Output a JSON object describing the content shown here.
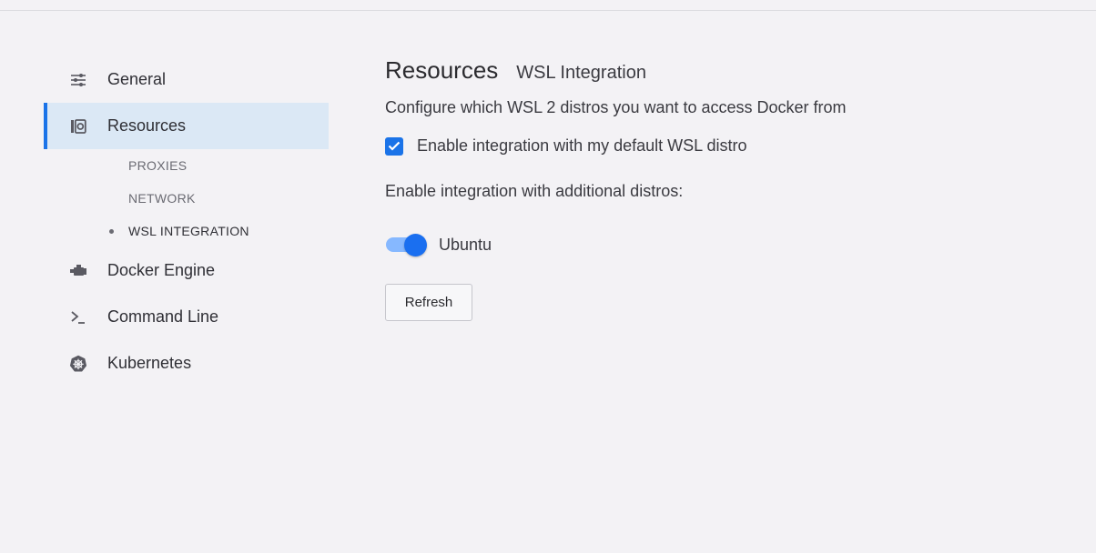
{
  "sidebar": {
    "items": [
      {
        "label": "General",
        "icon": "sliders-icon"
      },
      {
        "label": "Resources",
        "icon": "resources-icon"
      },
      {
        "label": "Docker Engine",
        "icon": "engine-icon"
      },
      {
        "label": "Command Line",
        "icon": "terminal-prompt-icon"
      },
      {
        "label": "Kubernetes",
        "icon": "kubernetes-helm-icon"
      }
    ],
    "sub_items": [
      {
        "label": "PROXIES"
      },
      {
        "label": "NETWORK"
      },
      {
        "label": "WSL INTEGRATION"
      }
    ],
    "active_item": "Resources",
    "active_sub_item": "WSL INTEGRATION"
  },
  "main": {
    "title": "Resources",
    "subtitle": "WSL Integration",
    "description": "Configure which WSL 2 distros you want to access Docker from",
    "default_checkbox": {
      "label": "Enable integration with my default WSL distro",
      "checked": true
    },
    "additional_label": "Enable integration with additional distros:",
    "distros": [
      {
        "name": "Ubuntu",
        "enabled": true
      }
    ],
    "refresh_label": "Refresh"
  },
  "colors": {
    "accent": "#1a73e8",
    "active_bg": "#dbe8f5",
    "background": "#f3f2f5"
  }
}
